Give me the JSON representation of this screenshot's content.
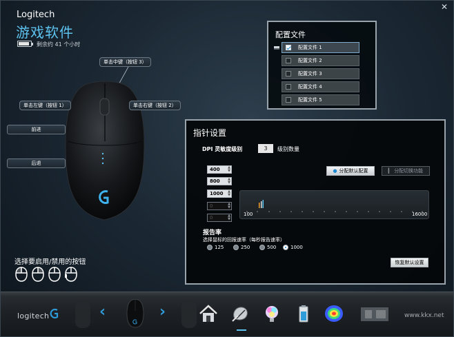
{
  "header": {
    "brand": "Logitech",
    "title": "游戏软件",
    "battery_text": "剩余约 41 个小时",
    "battery_level": 0.9
  },
  "mouse": {
    "callouts": {
      "middle": "单击中键（按钮 3）",
      "left": "单击左键（按钮 1）",
      "right": "单击右键（按钮 2）",
      "forward": "前进",
      "back": "后退"
    },
    "enable_label": "选择要启用/禁用的按钮"
  },
  "profiles": {
    "title": "配置文件",
    "items": [
      {
        "label": "配置文件 1",
        "checked": true
      },
      {
        "label": "配置文件 2",
        "checked": false
      },
      {
        "label": "配置文件 3",
        "checked": false
      },
      {
        "label": "配置文件 4",
        "checked": false
      },
      {
        "label": "配置文件 5",
        "checked": false
      }
    ]
  },
  "pointer": {
    "title": "指针设置",
    "dpi_label": "DPI 灵敏度级别",
    "dpi_count": "3",
    "dpi_count_label": "级别数量",
    "dpi_levels": [
      "400",
      "800",
      "1000",
      "0",
      "0"
    ],
    "assign_default": "分配默认配置",
    "assign_shift": "分配切换功能",
    "dpi_min": "100",
    "dpi_max": "16000",
    "report_rate_title": "报告率",
    "report_rate_sub": "选择鼠标的回报速率（每秒报告速率）",
    "report_rates": [
      "125",
      "250",
      "500",
      "1000"
    ],
    "report_rate_selected": "1000",
    "restore_default": "恢复默认设置"
  },
  "bottom": {
    "logo_text": "logitech"
  },
  "colors": {
    "accent": "#5ec3f0",
    "nav_blue": "#2f9bd8"
  },
  "watermark": "www.kkx.net"
}
